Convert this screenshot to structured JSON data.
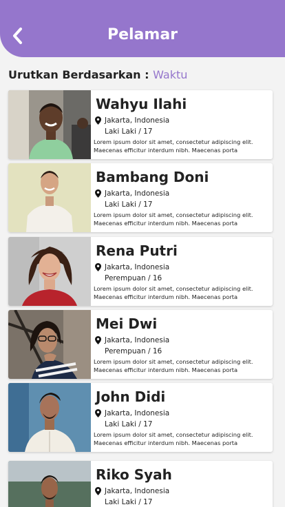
{
  "header": {
    "title": "Pelamar"
  },
  "sort": {
    "label": "Urutkan Berdasarkan :",
    "value": "Waktu"
  },
  "applicants": [
    {
      "name": "Wahyu Ilahi",
      "location": "Jakarta, Indonesia",
      "gender": "Laki Laki / 17",
      "desc": "Lorem ipsum dolor sit amet, consectetur adipiscing elit. Maecenas efficitur interdum nibh. Maecenas porta"
    },
    {
      "name": "Bambang Doni",
      "location": "Jakarta, Indonesia",
      "gender": "Laki Laki / 17",
      "desc": "Lorem ipsum dolor sit amet, consectetur adipiscing elit. Maecenas efficitur interdum nibh. Maecenas porta"
    },
    {
      "name": "Rena Putri",
      "location": "Jakarta, Indonesia",
      "gender": "Perempuan / 16",
      "desc": "Lorem ipsum dolor sit amet, consectetur adipiscing elit. Maecenas efficitur interdum nibh. Maecenas porta"
    },
    {
      "name": "Mei Dwi",
      "location": "Jakarta, Indonesia",
      "gender": "Perempuan / 16",
      "desc": "Lorem ipsum dolor sit amet, consectetur adipiscing elit. Maecenas efficitur interdum nibh. Maecenas porta"
    },
    {
      "name": "John Didi",
      "location": "Jakarta, Indonesia",
      "gender": "Laki Laki / 17",
      "desc": "Lorem ipsum dolor sit amet, consectetur adipiscing elit. Maecenas efficitur interdum nibh. Maecenas porta"
    },
    {
      "name": "Riko Syah",
      "location": "Jakarta, Indonesia",
      "gender": "Laki Laki / 17",
      "desc": ""
    }
  ],
  "colors": {
    "accent": "#9576cc",
    "background": "#f3f3f3"
  },
  "icons": {
    "back": "chevron-left-icon",
    "location": "location-pin-icon"
  }
}
